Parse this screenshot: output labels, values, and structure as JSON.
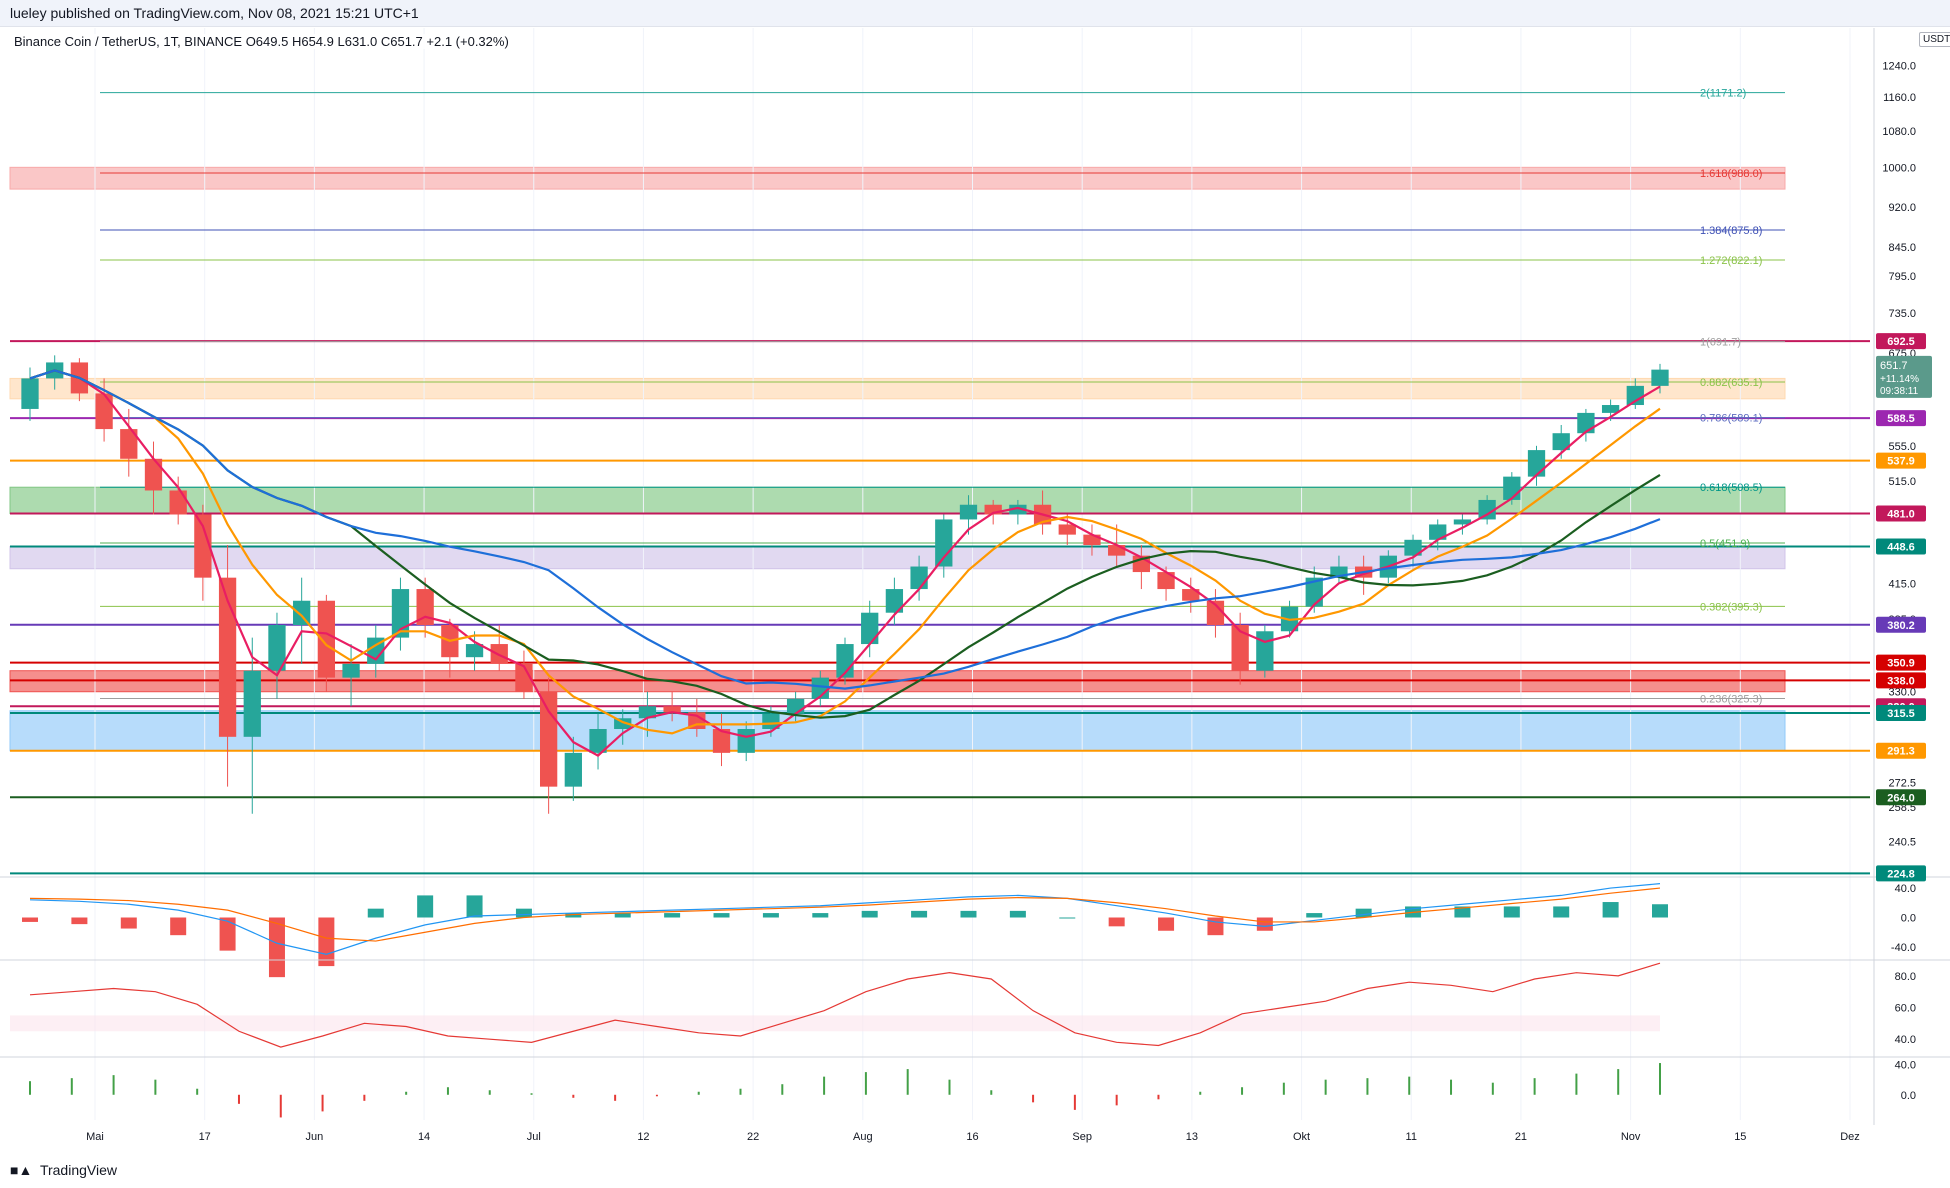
{
  "header": {
    "published_line": "lueley published on TradingView.com, Nov 08, 2021 15:21 UTC+1"
  },
  "legend": {
    "symbol_line": "Binance Coin / TetherUS, 1T, BINANCE  O649.5  H654.9  L631.0  C651.7  +2.1 (+0.32%)"
  },
  "footer": {
    "brand_icon": "tradingview-logo-icon",
    "brand_label": "TradingView"
  },
  "chart_data": {
    "type": "candlestick",
    "symbol": "BNBUSDT",
    "exchange": "BINANCE",
    "interval": "1T",
    "price_axis": {
      "unit_badge": "USDT",
      "scale": "log",
      "range": [
        224,
        1260
      ],
      "ticks": [
        "1240.0",
        "1160.0",
        "1080.0",
        "1000.0",
        "920.0",
        "845.0",
        "795.0",
        "735.0",
        "675.0",
        "555.0",
        "515.0",
        "415.0",
        "385.0",
        "350.0",
        "330.0",
        "272.5",
        "258.5",
        "240.5"
      ]
    },
    "time_axis": {
      "labels": [
        "Mai",
        "17",
        "Jun",
        "14",
        "Jul",
        "12",
        "22",
        "Aug",
        "16",
        "Sep",
        "13",
        "Okt",
        "11",
        "21",
        "Nov",
        "15",
        "Dez"
      ],
      "label_dates": [
        "2021-05-01",
        "2021-05-17",
        "2021-06-01",
        "2021-06-14",
        "2021-07-01",
        "2021-07-12",
        "2021-07-22",
        "2021-08-01",
        "2021-08-16",
        "2021-09-01",
        "2021-09-13",
        "2021-10-01",
        "2021-10-11",
        "2021-10-21",
        "2021-11-01",
        "2021-11-15",
        "2021-12-01"
      ]
    },
    "current": {
      "price": "651.7",
      "change": "+11.14%",
      "countdown": "09:38:11",
      "color": "#5b9a8b"
    },
    "fib_levels": [
      {
        "label": "2(1171.2)",
        "price": 1171.2,
        "color": "#26a69a"
      },
      {
        "label": "1.618(988.0)",
        "price": 988.0,
        "color": "#e53935"
      },
      {
        "label": "1.384(875.8)",
        "price": 875.8,
        "color": "#3f51b5"
      },
      {
        "label": "1.272(822.1)",
        "price": 822.1,
        "color": "#8bc34a"
      },
      {
        "label": "1(691.7)",
        "price": 691.7,
        "color": "#9e9e9e"
      },
      {
        "label": "0.882(635.1)",
        "price": 635.1,
        "color": "#8bc34a"
      },
      {
        "label": "0.786(589.1)",
        "price": 589.1,
        "color": "#5c6bc0"
      },
      {
        "label": "0.618(508.5)",
        "price": 508.5,
        "color": "#009688"
      },
      {
        "label": "0.5(451.9)",
        "price": 451.9,
        "color": "#4caf50"
      },
      {
        "label": "0.382(395.3)",
        "price": 395.3,
        "color": "#8bc34a"
      },
      {
        "label": "0.236(325.3)",
        "price": 325.3,
        "color": "#9e9e9e"
      }
    ],
    "horizontal_levels": [
      {
        "label": "692.5",
        "price": 692.5,
        "color": "#c2185b"
      },
      {
        "label": "588.5",
        "price": 588.5,
        "color": "#9c27b0"
      },
      {
        "label": "537.9",
        "price": 537.9,
        "color": "#ff9800"
      },
      {
        "label": "481.0",
        "price": 481.0,
        "color": "#c2185b"
      },
      {
        "label": "448.6",
        "price": 448.6,
        "color": "#00897b"
      },
      {
        "label": "380.2",
        "price": 380.2,
        "color": "#673ab7"
      },
      {
        "label": "350.9",
        "price": 350.9,
        "color": "#d50000"
      },
      {
        "label": "338.0",
        "price": 338.0,
        "color": "#d50000"
      },
      {
        "label": "320.0",
        "price": 320.0,
        "color": "#c2185b"
      },
      {
        "label": "315.5",
        "price": 315.5,
        "color": "#00897b"
      },
      {
        "label": "291.3",
        "price": 291.3,
        "color": "#ff9800"
      },
      {
        "label": "264.0",
        "price": 264.0,
        "color": "#1b5e20"
      },
      {
        "label": "224.8",
        "price": 224.8,
        "color": "#00897b"
      }
    ],
    "zones": [
      {
        "name": "fib-extension-zone",
        "from": 955,
        "to": 1000,
        "color": "#f8a9a9"
      },
      {
        "name": "resistance-zone",
        "from": 613,
        "to": 640,
        "color": "#ffd9b0"
      },
      {
        "name": "green-support-zone",
        "from": 481,
        "to": 508.5,
        "color": "#81c784"
      },
      {
        "name": "purple-zone",
        "from": 428,
        "to": 448.6,
        "color": "#d1c4e9"
      },
      {
        "name": "red-support-zone",
        "from": 330,
        "to": 345,
        "color": "#ef5350"
      },
      {
        "name": "blue-support-zone",
        "from": 291.3,
        "to": 317,
        "color": "#90caf9"
      }
    ],
    "macd_pane": {
      "ticks": [
        "40.0",
        "0.0",
        "-40.0"
      ],
      "macd": [
        24,
        22,
        18,
        10,
        -5,
        -35,
        -50,
        -28,
        -10,
        2,
        4,
        6,
        8,
        10,
        12,
        14,
        16,
        20,
        24,
        28,
        30,
        26,
        16,
        6,
        -6,
        -12,
        -4,
        4,
        12,
        18,
        24,
        30,
        40,
        46
      ],
      "signal": [
        26,
        25,
        23,
        18,
        10,
        -8,
        -28,
        -32,
        -20,
        -8,
        0,
        4,
        6,
        8,
        10,
        12,
        14,
        17,
        21,
        25,
        27,
        26,
        20,
        12,
        2,
        -6,
        -6,
        0,
        7,
        13,
        19,
        25,
        33,
        40
      ],
      "hist_colors": {
        "pos_rising": "#26a69a",
        "pos_falling": "#b2dfdb",
        "neg_falling": "#ef5350",
        "neg_rising": "#ffcdd2"
      }
    },
    "rsi_pane": {
      "ticks": [
        "80.0",
        "60.0",
        "40.0"
      ],
      "upper_band": 55,
      "lower_band": 45,
      "values": [
        68,
        70,
        72,
        70,
        62,
        45,
        35,
        42,
        50,
        48,
        42,
        40,
        38,
        45,
        52,
        48,
        44,
        42,
        50,
        58,
        70,
        78,
        82,
        78,
        58,
        44,
        38,
        36,
        44,
        56,
        60,
        64,
        72,
        76,
        74,
        70,
        78,
        82,
        80,
        88
      ]
    },
    "momentum_pane": {
      "ticks": [
        "40.0",
        "0.0"
      ],
      "values": [
        18,
        22,
        26,
        20,
        8,
        -12,
        -30,
        -22,
        -8,
        4,
        10,
        6,
        2,
        -4,
        -8,
        -2,
        4,
        8,
        14,
        24,
        30,
        34,
        20,
        6,
        -10,
        -20,
        -14,
        -6,
        4,
        10,
        16,
        20,
        22,
        24,
        20,
        16,
        22,
        28,
        34,
        42
      ]
    },
    "candles": [
      [
        600,
        655,
        585,
        640
      ],
      [
        640,
        672,
        625,
        662
      ],
      [
        662,
        668,
        610,
        620
      ],
      [
        620,
        640,
        560,
        575
      ],
      [
        575,
        600,
        520,
        540
      ],
      [
        540,
        560,
        480,
        505
      ],
      [
        505,
        520,
        470,
        480
      ],
      [
        480,
        490,
        400,
        420
      ],
      [
        420,
        450,
        270,
        300
      ],
      [
        300,
        370,
        255,
        345
      ],
      [
        345,
        390,
        325,
        380
      ],
      [
        380,
        420,
        350,
        400
      ],
      [
        400,
        405,
        330,
        340
      ],
      [
        340,
        365,
        320,
        350
      ],
      [
        350,
        380,
        340,
        370
      ],
      [
        370,
        420,
        360,
        410
      ],
      [
        410,
        420,
        370,
        380
      ],
      [
        380,
        385,
        340,
        355
      ],
      [
        355,
        375,
        345,
        365
      ],
      [
        365,
        380,
        345,
        350
      ],
      [
        350,
        360,
        325,
        330
      ],
      [
        330,
        340,
        255,
        270
      ],
      [
        270,
        300,
        262,
        290
      ],
      [
        290,
        315,
        280,
        305
      ],
      [
        305,
        318,
        295,
        312
      ],
      [
        312,
        330,
        300,
        320
      ],
      [
        320,
        330,
        310,
        316
      ],
      [
        316,
        325,
        300,
        305
      ],
      [
        305,
        315,
        282,
        290
      ],
      [
        290,
        310,
        285,
        305
      ],
      [
        305,
        320,
        300,
        315
      ],
      [
        315,
        330,
        310,
        325
      ],
      [
        325,
        345,
        320,
        340
      ],
      [
        340,
        370,
        335,
        365
      ],
      [
        365,
        400,
        355,
        390
      ],
      [
        390,
        420,
        380,
        410
      ],
      [
        410,
        440,
        400,
        430
      ],
      [
        430,
        480,
        420,
        475
      ],
      [
        475,
        500,
        460,
        490
      ],
      [
        490,
        495,
        470,
        480
      ],
      [
        480,
        495,
        470,
        490
      ],
      [
        490,
        505,
        460,
        470
      ],
      [
        470,
        480,
        450,
        460
      ],
      [
        460,
        470,
        440,
        450
      ],
      [
        450,
        470,
        430,
        440
      ],
      [
        440,
        450,
        410,
        425
      ],
      [
        425,
        430,
        400,
        410
      ],
      [
        410,
        420,
        390,
        400
      ],
      [
        400,
        410,
        370,
        380
      ],
      [
        380,
        390,
        335,
        345
      ],
      [
        345,
        380,
        340,
        375
      ],
      [
        375,
        400,
        370,
        395
      ],
      [
        395,
        430,
        390,
        420
      ],
      [
        420,
        440,
        415,
        430
      ],
      [
        430,
        440,
        405,
        420
      ],
      [
        420,
        445,
        415,
        440
      ],
      [
        440,
        460,
        430,
        455
      ],
      [
        455,
        475,
        445,
        470
      ],
      [
        470,
        480,
        460,
        475
      ],
      [
        475,
        500,
        470,
        495
      ],
      [
        495,
        525,
        490,
        520
      ],
      [
        520,
        555,
        510,
        550
      ],
      [
        550,
        580,
        540,
        570
      ],
      [
        570,
        600,
        560,
        595
      ],
      [
        595,
        612,
        585,
        605
      ],
      [
        605,
        640,
        600,
        630
      ],
      [
        630,
        660,
        620,
        652
      ]
    ]
  }
}
